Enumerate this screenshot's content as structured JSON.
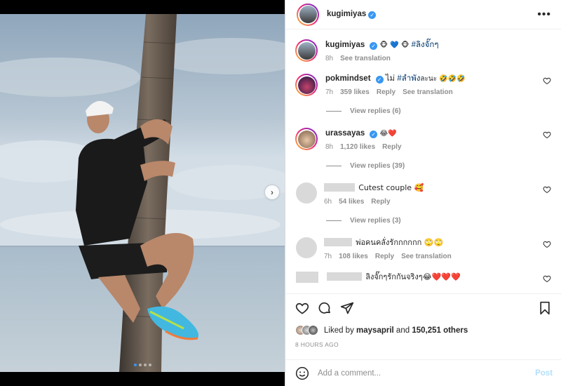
{
  "post": {
    "author": "kugimiyas",
    "caption_emoji": "🐵 💙 🐵",
    "caption_hashtag": "#ลิงจั๊กๆ",
    "caption_time": "8h",
    "see_translation": "See translation",
    "carousel_dots": 4,
    "carousel_active": 1
  },
  "comments": [
    {
      "user": "pokmindset",
      "verified": true,
      "text_plain": "ไม่ ",
      "text_hashtag": "#ลำพัง",
      "text_after": " ละนะ 🤣🤣🤣",
      "time": "7h",
      "likes": "359 likes",
      "reply": "Reply",
      "translate": "See translation",
      "view_replies": "View replies (6)"
    },
    {
      "user": "urassayas",
      "verified": true,
      "text_after": "😂❤️",
      "time": "8h",
      "likes": "1,120 likes",
      "reply": "Reply",
      "view_replies": "View replies (39)"
    },
    {
      "text_after": "Cutest couple 🥰",
      "time": "6h",
      "likes": "54 likes",
      "reply": "Reply",
      "view_replies": "View replies (3)"
    },
    {
      "text_after": "พ่อคนคลั่งรักกกกกก 🙄🙄",
      "time": "7h",
      "likes": "108 likes",
      "reply": "Reply",
      "translate": "See translation"
    },
    {
      "text_after": "ลิงจั๊กๆรักกันจริงๆ😂❤️❤️❤️"
    }
  ],
  "liked_by": {
    "prefix": "Liked by ",
    "user": "maysapril",
    "middle": " and ",
    "count": "150,251 others"
  },
  "timestamp": "8 HOURS AGO",
  "add_comment": {
    "placeholder": "Add a comment...",
    "post_label": "Post"
  },
  "icons": {
    "like": "heart-icon",
    "comment": "comment-icon",
    "share": "share-icon",
    "save": "bookmark-icon",
    "emoji": "smiley-icon",
    "more": "more-icon",
    "next": "chevron-right-icon"
  },
  "colors": {
    "link": "#00376b",
    "verified": "#3897f0",
    "muted": "#8e8e8e",
    "post_button": "#b2dffc"
  }
}
